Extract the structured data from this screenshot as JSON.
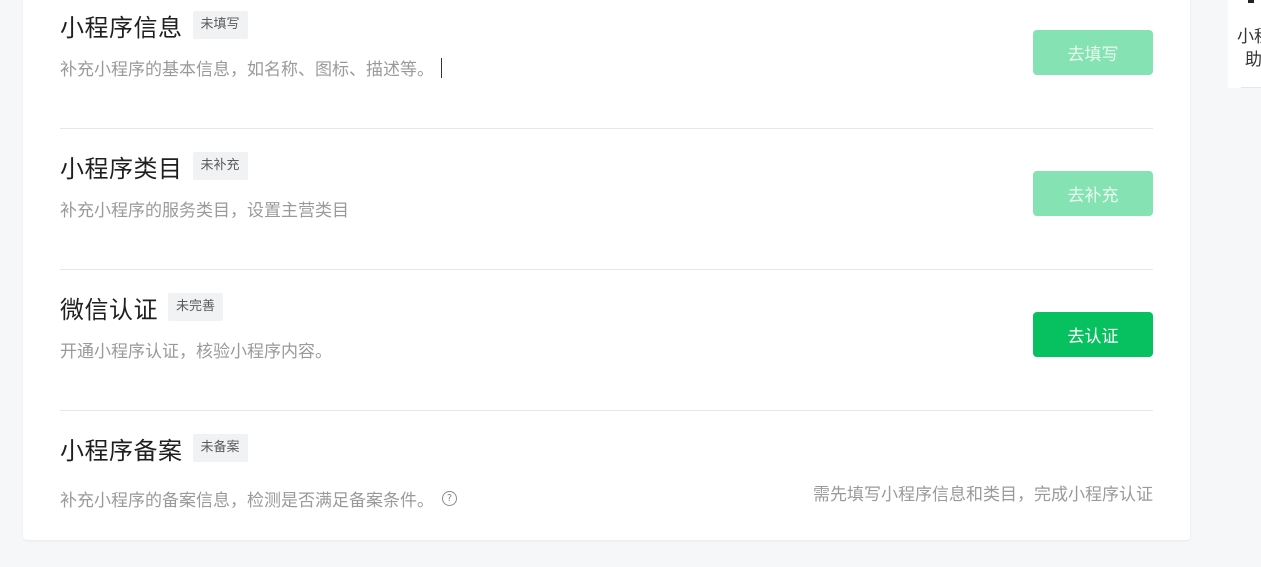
{
  "items": [
    {
      "title": "小程序信息",
      "badge": "未填写",
      "desc": "补充小程序的基本信息，如名称、图标、描述等。",
      "button": "去填写"
    },
    {
      "title": "小程序类目",
      "badge": "未补充",
      "desc": "补充小程序的服务类目，设置主营类目",
      "button": "去补充"
    },
    {
      "title": "微信认证",
      "badge": "未完善",
      "desc": "开通小程序认证，核验小程序内容。",
      "button": "去认证"
    },
    {
      "title": "小程序备案",
      "badge": "未备案",
      "desc": "补充小程序的备案信息，检测是否满足备案条件。",
      "hint": "需先填写小程序信息和类目，完成小程序认证",
      "help_icon": "?"
    }
  ],
  "side_panel": {
    "line1": "小程",
    "line2": "助"
  },
  "colors": {
    "primary_green": "#07c160",
    "disabled_green": "#85e2b2",
    "text_gray": "#9a9a9a"
  },
  "icons": {
    "help": "question-circle-icon"
  }
}
